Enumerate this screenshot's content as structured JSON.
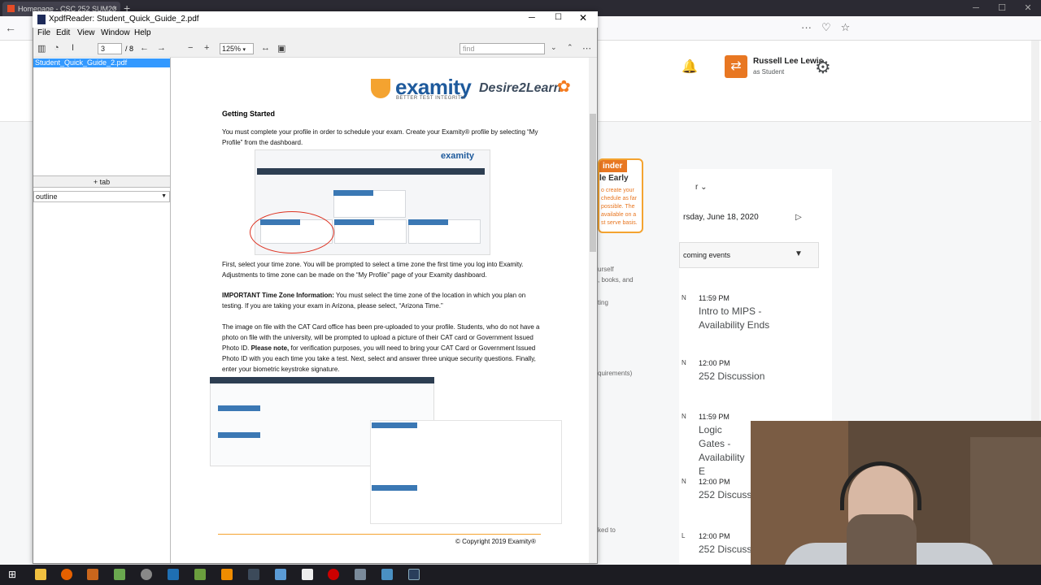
{
  "browser": {
    "tab_title": "Homepage - CSC 252 SUM20",
    "new_tab": "+",
    "tab_close": "×",
    "win_min": "─",
    "win_max": "☐",
    "win_close": "✕"
  },
  "webpage": {
    "user_name": "Russell Lee Lewis",
    "user_role": "as Student",
    "reminder_tag": "inder",
    "reminder_title": "le Early",
    "reminder_text": "o create your chedule as far possible. The available on a st serve basis.",
    "mid_text_1": "urself",
    "mid_text_2": ", books, and",
    "mid_text_3": "ting",
    "mid_text_4": "quirements)",
    "mid_text_5": "ked to",
    "calendar_label": "r",
    "calendar_date": "rsday, June 18, 2020",
    "upcoming_label": "coming events",
    "events": [
      {
        "time": "11:59 PM",
        "title": "Intro to MIPS - Availability Ends",
        "side": "N"
      },
      {
        "time": "12:00 PM",
        "title": "252 Discussion",
        "side": "N"
      },
      {
        "time": "11:59 PM",
        "title": "Logic Gates - Availability E",
        "side": "N"
      },
      {
        "time": "12:00 PM",
        "title": "252 Discussi",
        "side": "N"
      },
      {
        "time": "12:00 PM",
        "title": "252 Discussi",
        "side": "L"
      }
    ]
  },
  "xpdf": {
    "title": "XpdfReader: Student_Quick_Guide_2.pdf",
    "menu": [
      "File",
      "Edit",
      "View",
      "Window",
      "Help"
    ],
    "page_value": "3",
    "page_count": "/ 8",
    "zoom_value": "125%",
    "find_placeholder": "find",
    "file_name": "Student_Quick_Guide_2.pdf",
    "tab_button": "+ tab",
    "outline_label": "outline"
  },
  "pdf": {
    "logo_brand": "examity",
    "logo_tagline": "BETTER TEST INTEGRITY.",
    "logo_partner": "Desire2Learn",
    "heading": "Getting Started",
    "para1": "You must complete your profile in order to schedule your exam.  Create your Examity® profile by selecting “My Profile” from the dashboard.",
    "para2": "First, select your time zone. You will be prompted to select a time zone the first time you log into Examity.  Adjustments to time zone can be made on the “My Profile” page of your Examity dashboard.",
    "para3_bold": "IMPORTANT Time Zone Information:",
    "para3_rest": " You must select the time zone of the location in which you plan on testing.  If you are taking your exam in Arizona, please select, “Arizona Time.”",
    "para4_a": "The image on file with the CAT Card office has been pre-uploaded to your profile.  Students, who do not have a photo on file with the university, will be prompted to upload a picture of their CAT card or Government Issued Photo ID.",
    "para4_bold": "Please note,",
    "para4_b": " for verification purposes, you will need to bring your CAT Card or Government Issued Photo ID with you each time you take a test.   Next, select and answer three unique security questions.  Finally, enter your biometric keystroke signature.",
    "copyright": "© Copyright 2019 Examity®",
    "img1_logo": "examity",
    "img1_boxes": [
      "Start Exam",
      "My Profile",
      "Schedule Exam",
      "Reschedule/Cancel"
    ]
  },
  "colors": {
    "accent_orange": "#e87722",
    "examity_blue": "#1e5a9c",
    "selection_blue": "#3399ff"
  }
}
